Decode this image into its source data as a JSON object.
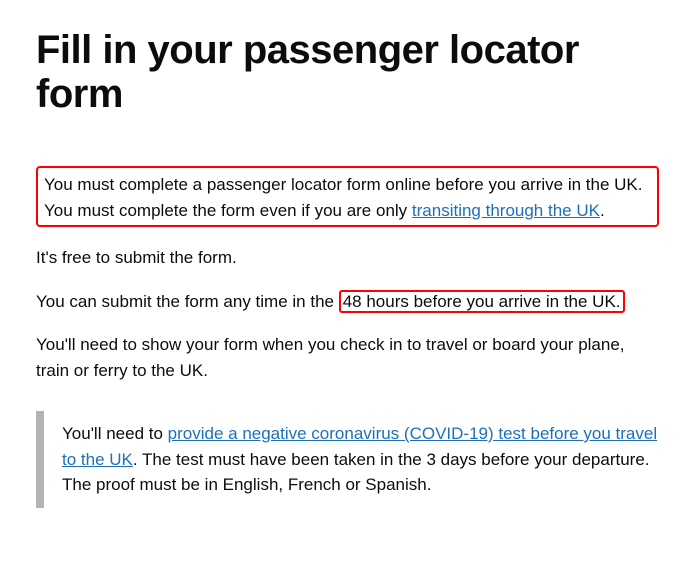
{
  "heading": "Fill in your passenger locator form",
  "para1": {
    "before": "You must complete a passenger locator form online before you arrive in the UK. You must complete the form even if you are only ",
    "link": "transiting through the UK",
    "after": "."
  },
  "para2": "It's free to submit the form.",
  "para3": {
    "before": "You can submit the form any time in the ",
    "highlight": "48 hours before you arrive in the UK.",
    "after": ""
  },
  "para4": "You'll need to show your form when you check in to travel or board your plane, train or ferry to the UK.",
  "inset": {
    "before": "You'll need to ",
    "link": "provide a negative coronavirus (COVID-19) test before you travel to the UK",
    "after": ". The test must have been taken in the 3 days before your departure. The proof must be in English, French or Spanish."
  }
}
